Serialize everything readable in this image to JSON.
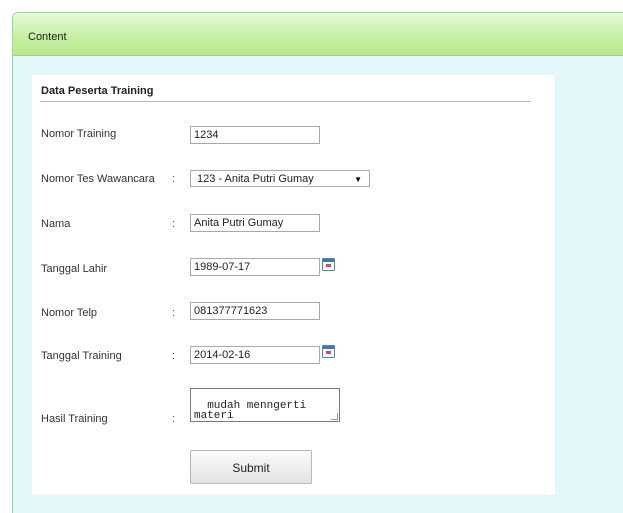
{
  "panel": {
    "title": "Content"
  },
  "form": {
    "title": "Data Peserta Training",
    "fields": {
      "nomor_training": {
        "label": "Nomor Training",
        "value": "1234"
      },
      "nomor_tes": {
        "label": "Nomor Tes Wawancara",
        "value": "123 - Anita Putri Gumay"
      },
      "nama": {
        "label": "Nama",
        "value": "Anita Putri Gumay"
      },
      "tanggal_lahir": {
        "label": "Tanggal Lahir",
        "value": "1989-07-17"
      },
      "nomor_telp": {
        "label": "Nomor Telp",
        "value": "081377771623"
      },
      "tanggal_training": {
        "label": "Tanggal Training",
        "value": "2014-02-16"
      },
      "hasil_training": {
        "label": "Hasil Training",
        "value": "mudah menngerti\nmateri"
      }
    },
    "colon": ":",
    "submit_label": "Submit"
  },
  "icons": {
    "calendar": "calendar-icon",
    "dropdown": "chevron-down-icon"
  }
}
